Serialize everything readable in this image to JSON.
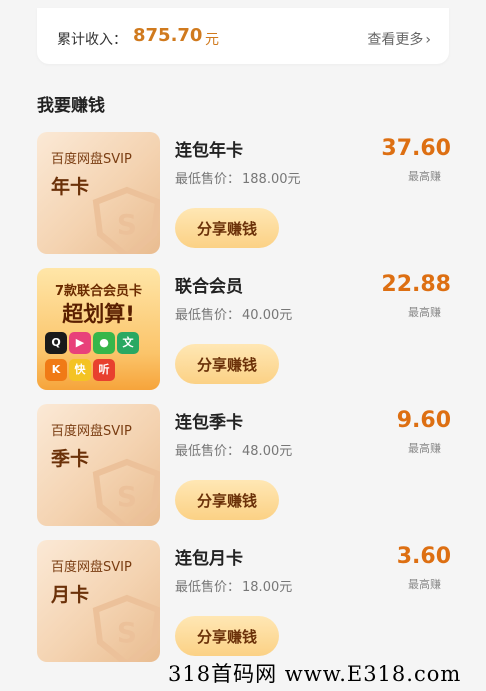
{
  "income": {
    "label": "累计收入：",
    "value": "875.70",
    "unit": "元",
    "more": "查看更多",
    "more_chevron": "›"
  },
  "section": {
    "title": "我要赚钱"
  },
  "common": {
    "price_label": "最低售价：",
    "earn_label": "最高赚",
    "share_button": "分享赚钱",
    "svip_brand": "百度网盘SVIP",
    "shield_letter": "S"
  },
  "products": [
    {
      "title": "连包年卡",
      "min_price": "188.00元",
      "earn": "37.60",
      "thumb_kind": "年卡"
    },
    {
      "title": "联合会员",
      "min_price": "40.00元",
      "earn": "22.88",
      "thumb_line1": "7款联合会员卡",
      "thumb_line2": "超划算!",
      "apps": [
        {
          "label": "Q",
          "icon": "qq-icon",
          "color": "#1a1a1a"
        },
        {
          "label": "▶",
          "icon": "youku-icon",
          "color": "#e8417a"
        },
        {
          "label": "●",
          "icon": "aiqiyi-icon",
          "color": "#37b64a"
        },
        {
          "label": "文",
          "icon": "wenku-icon",
          "color": "#2aa862"
        },
        {
          "label": "K",
          "icon": "kuaikan-icon",
          "color": "#f07a16"
        },
        {
          "label": "快",
          "icon": "kuaiduo-icon",
          "color": "#f4c324"
        },
        {
          "label": "听",
          "icon": "ting-icon",
          "color": "#e8402e"
        }
      ]
    },
    {
      "title": "连包季卡",
      "min_price": "48.00元",
      "earn": "9.60",
      "thumb_kind": "季卡"
    },
    {
      "title": "连包月卡",
      "min_price": "18.00元",
      "earn": "3.60",
      "thumb_kind": "月卡"
    }
  ],
  "watermark": "318首码网 www.E318.com"
}
